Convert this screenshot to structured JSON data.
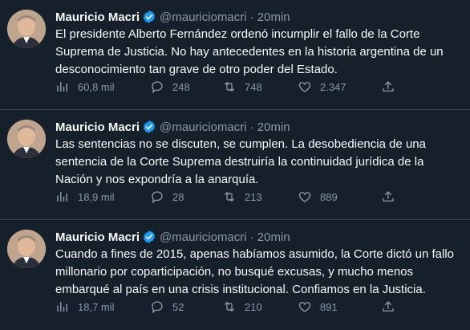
{
  "tweets": [
    {
      "name": "Mauricio Macri",
      "handle": "@mauriciomacri",
      "time": "· 20min",
      "text": "El presidente Alberto Fernández ordenó incumplir el fallo de la Corte Suprema de Justicia. No hay antecedentes en la historia argentina de un desconocimiento tan grave de otro poder del Estado.",
      "views": "60,8 mil",
      "replies": "248",
      "retweets": "748",
      "likes": "2.347"
    },
    {
      "name": "Mauricio Macri",
      "handle": "@mauriciomacri",
      "time": "· 20min",
      "text": "Las sentencias no se discuten, se cumplen. La desobediencia de una sentencia de la Corte Suprema destruiría la continuidad jurídica de la Nación y nos expondría a la anarquía.",
      "views": "18,9 mil",
      "replies": "28",
      "retweets": "213",
      "likes": "889"
    },
    {
      "name": "Mauricio Macri",
      "handle": "@mauriciomacri",
      "time": "· 20min",
      "text": "Cuando a fines de 2015, apenas habíamos asumido, la Corte dictó un fallo millonario por coparticipación, no busqué excusas, y mucho menos embarqué al país en una crisis institucional. Confiamos en la Justicia.",
      "views": "18,7 mil",
      "replies": "52",
      "retweets": "210",
      "likes": "891"
    }
  ],
  "colors": {
    "background": "#15202b",
    "text": "#f7f9f9",
    "muted": "#8b98a5",
    "verified": "#1d9bf0",
    "divider": "#38444d"
  },
  "icons": [
    "avatar",
    "verified-badge-icon",
    "views-icon",
    "reply-icon",
    "retweet-icon",
    "like-icon",
    "share-icon"
  ]
}
